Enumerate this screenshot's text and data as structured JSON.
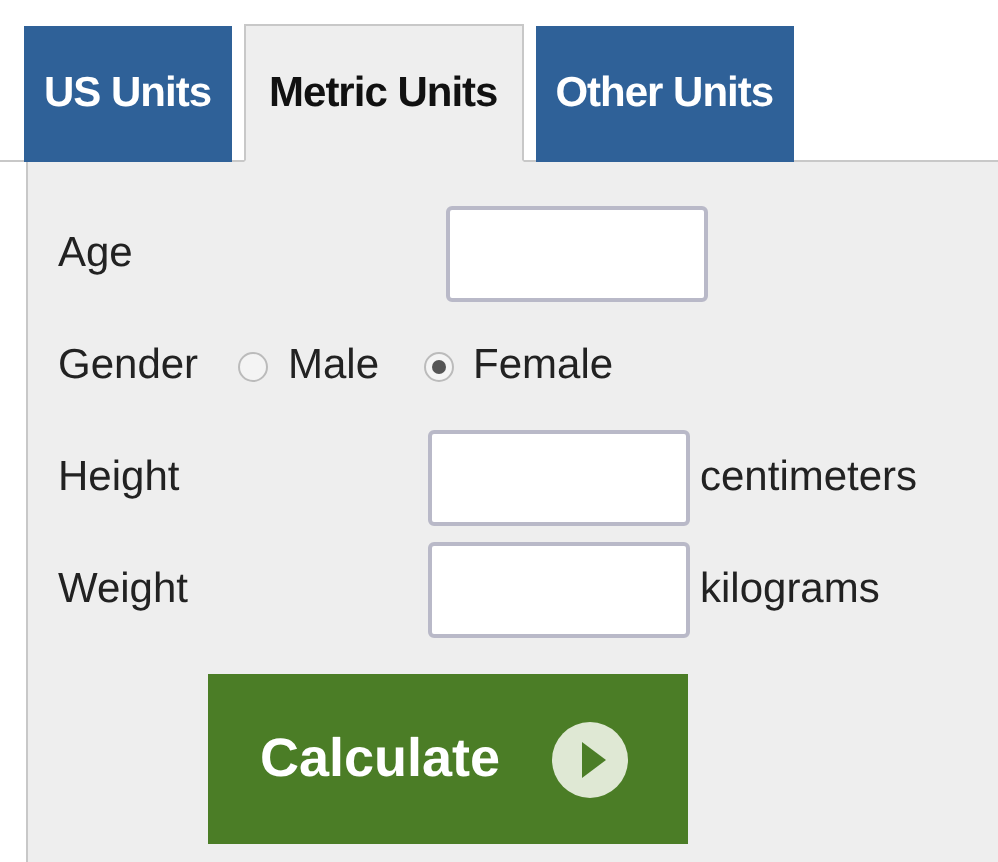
{
  "tabs": [
    {
      "label": "US Units",
      "selected": false
    },
    {
      "label": "Metric Units",
      "selected": true
    },
    {
      "label": "Other Units",
      "selected": false
    }
  ],
  "fields": [
    {
      "kind": "text",
      "label": "Age"
    },
    {
      "kind": "radio",
      "label": "Gender",
      "options": [
        {
          "label": "Male",
          "selected": false
        },
        {
          "label": "Female",
          "selected": true
        }
      ]
    },
    {
      "kind": "text",
      "label": "Height",
      "unit": "centimeters"
    },
    {
      "kind": "text",
      "label": "Weight",
      "unit": "kilograms"
    }
  ],
  "button": {
    "label": "Calculate"
  }
}
